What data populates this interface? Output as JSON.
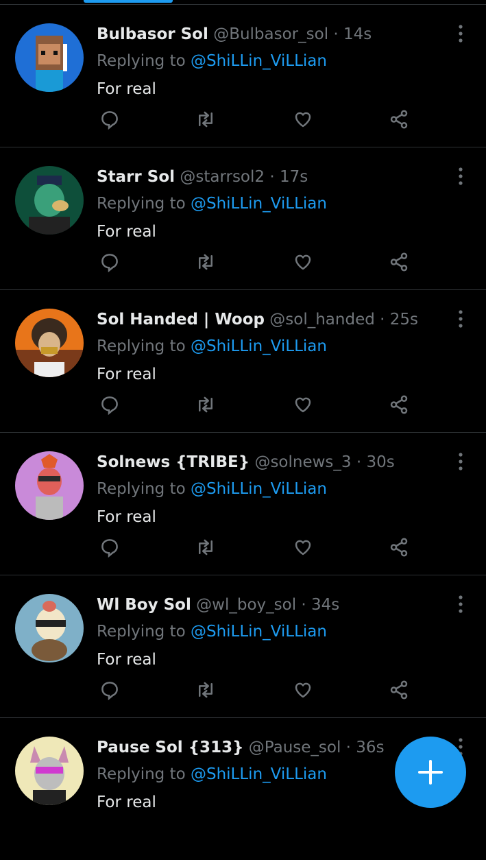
{
  "replies": [
    {
      "name": "Bulbasor Sol",
      "handle": "@Bulbasor_sol",
      "sep": "·",
      "time": "14s",
      "replying_prefix": "Replying to",
      "replying_to": "@ShiLLin_ViLLian",
      "text": "For real"
    },
    {
      "name": "Starr Sol",
      "handle": "@starrsol2",
      "sep": "·",
      "time": "17s",
      "replying_prefix": "Replying to",
      "replying_to": "@ShiLLin_ViLLian",
      "text": "For real"
    },
    {
      "name": "Sol Handed | Woop",
      "handle": "@sol_handed",
      "sep": "·",
      "time": "25s",
      "replying_prefix": "Replying to",
      "replying_to": "@ShiLLin_ViLLian",
      "text": "For real"
    },
    {
      "name": "Solnews {TRIBE}",
      "handle": "@solnews_3",
      "sep": "·",
      "time": "30s",
      "replying_prefix": "Replying to",
      "replying_to": "@ShiLLin_ViLLian",
      "text": "For real"
    },
    {
      "name": "Wl Boy Sol",
      "handle": "@wl_boy_sol",
      "sep": "·",
      "time": "34s",
      "replying_prefix": "Replying to",
      "replying_to": "@ShiLLin_ViLLian",
      "text": "For real"
    },
    {
      "name": "Pause Sol {313}",
      "handle": "@Pause_sol",
      "sep": "·",
      "time": "36s",
      "replying_prefix": "Replying to",
      "replying_to": "@ShiLLin_ViLLian",
      "text": "For real"
    }
  ],
  "icons": {
    "reply": "reply-icon",
    "retweet": "retweet-icon",
    "like": "heart-icon",
    "share": "share-icon",
    "more": "more-vertical-icon",
    "compose": "plus-icon"
  },
  "colors": {
    "background": "#000000",
    "accent": "#1d9bf0",
    "muted": "#71767b",
    "text": "#e7e9ea",
    "divider": "#2f3336"
  }
}
